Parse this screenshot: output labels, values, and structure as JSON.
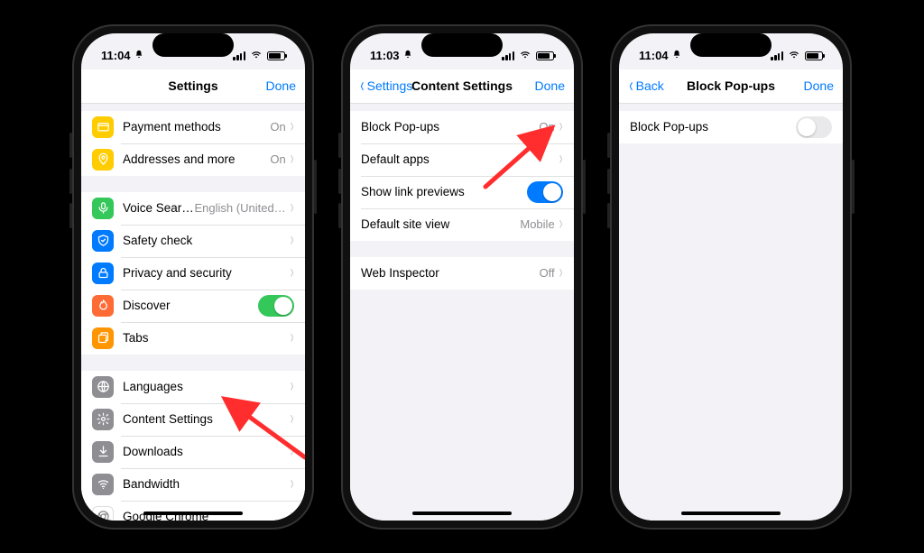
{
  "statusbar": {
    "time1": "11:04",
    "time2": "11:03",
    "time3": "11:04"
  },
  "phone1": {
    "nav": {
      "title": "Settings",
      "done": "Done"
    },
    "g1": [
      {
        "icon": "wallet-icon",
        "iconClass": "ic-yellow",
        "glyph": "card",
        "label": "Payment methods",
        "detail": "On"
      },
      {
        "icon": "address-icon",
        "iconClass": "ic-yellow",
        "glyph": "pin",
        "label": "Addresses and more",
        "detail": "On"
      }
    ],
    "g2": [
      {
        "icon": "voice-search-icon",
        "iconClass": "ic-green",
        "glyph": "mic",
        "label": "Voice Search",
        "detail": "English (United…"
      },
      {
        "icon": "safety-check-icon",
        "iconClass": "ic-blue",
        "glyph": "shield",
        "label": "Safety check"
      },
      {
        "icon": "privacy-icon",
        "iconClass": "ic-blue",
        "glyph": "lock",
        "label": "Privacy and security"
      },
      {
        "icon": "discover-icon",
        "iconClass": "ic-orange2",
        "glyph": "flame",
        "label": "Discover",
        "toggle": true
      },
      {
        "icon": "tabs-icon",
        "iconClass": "ic-orange",
        "glyph": "tabs",
        "label": "Tabs"
      }
    ],
    "g3": [
      {
        "icon": "languages-icon",
        "iconClass": "ic-gray",
        "glyph": "globe",
        "label": "Languages"
      },
      {
        "icon": "content-icon",
        "iconClass": "ic-gray",
        "glyph": "gear",
        "label": "Content Settings"
      },
      {
        "icon": "downloads-icon",
        "iconClass": "ic-gray",
        "glyph": "download",
        "label": "Downloads"
      },
      {
        "icon": "bandwidth-icon",
        "iconClass": "ic-gray",
        "glyph": "wifi",
        "label": "Bandwidth"
      },
      {
        "icon": "chrome-icon",
        "iconClass": "ic-white",
        "glyph": "chrome",
        "label": "Google Chrome"
      }
    ]
  },
  "phone2": {
    "nav": {
      "back": "Settings",
      "title": "Content Settings",
      "done": "Done"
    },
    "g1": [
      {
        "label": "Block Pop-ups",
        "detail": "On",
        "chevron": true
      },
      {
        "label": "Default apps",
        "chevron": true
      },
      {
        "label": "Show link previews",
        "toggle": true,
        "toggleClass": "blue"
      },
      {
        "label": "Default site view",
        "detail": "Mobile",
        "chevron": true
      }
    ],
    "g2": [
      {
        "label": "Web Inspector",
        "detail": "Off",
        "chevron": true
      }
    ]
  },
  "phone3": {
    "nav": {
      "back": "Back",
      "title": "Block Pop-ups",
      "done": "Done"
    },
    "g1": [
      {
        "label": "Block Pop-ups",
        "toggle": false
      }
    ]
  }
}
